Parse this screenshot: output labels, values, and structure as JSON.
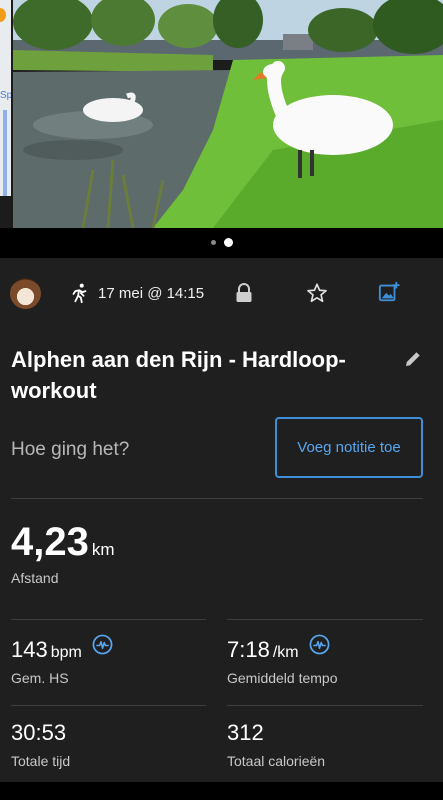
{
  "map": {
    "label_fragment": "Sp"
  },
  "gallery": {
    "pages": 2,
    "active_page": 2
  },
  "activity": {
    "date": "17 mei @ 14:15",
    "title": "Alphen aan den Rijn - Hardloop-workout",
    "prompt": "Hoe ging het?",
    "add_note_label": "Voeg notitie toe"
  },
  "stats": {
    "distance": {
      "value": "4,23",
      "unit": "km",
      "label": "Afstand"
    },
    "heart_rate": {
      "value": "143",
      "unit": "bpm",
      "label": "Gem. HS"
    },
    "pace": {
      "value": "7:18",
      "unit": "/km",
      "label": "Gemiddeld tempo"
    },
    "time": {
      "value": "30:53",
      "label": "Totale tijd"
    },
    "calories": {
      "value": "312",
      "label": "Totaal calorieën"
    }
  },
  "colors": {
    "accent": "#3f8fd8",
    "card_bg": "#1f1f1f",
    "page_bg": "#000000"
  },
  "icons": [
    "running-icon",
    "lock-icon",
    "star-icon",
    "add-photo-icon",
    "edit-icon",
    "heart-rate-icon"
  ]
}
